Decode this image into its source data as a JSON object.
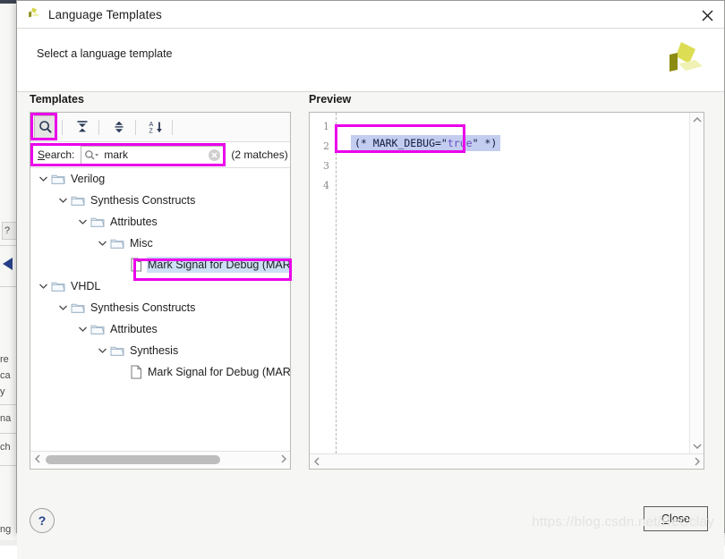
{
  "window": {
    "title": "Language Templates",
    "close_icon": "close-x-icon",
    "app_logo": "xilinx-logo-icon"
  },
  "header": {
    "subtitle": "Select a language template",
    "logo": "xilinx-vivado-logo-icon"
  },
  "templates": {
    "panel_title": "Templates",
    "toolbar": [
      {
        "name": "search-toggle",
        "icon": "magnifier-icon",
        "active": true
      },
      {
        "name": "collapse-all",
        "icon": "collapse-all-icon",
        "active": false
      },
      {
        "name": "expand-all",
        "icon": "expand-all-icon",
        "active": false
      },
      {
        "name": "sort-az",
        "icon": "sort-alpha-down-icon",
        "active": false
      }
    ],
    "search": {
      "label": "Search:",
      "label_mnemonic": "S",
      "value": "mark",
      "placeholder": "",
      "icon": "magnifier-dropdown-icon",
      "clear_icon": "clear-circle-icon",
      "match_count": "(2 matches)"
    },
    "tree": [
      {
        "label": "Verilog",
        "depth": 0,
        "type": "folder",
        "expanded": true,
        "selected": false
      },
      {
        "label": "Synthesis Constructs",
        "depth": 1,
        "type": "folder",
        "expanded": true,
        "selected": false
      },
      {
        "label": "Attributes",
        "depth": 2,
        "type": "folder",
        "expanded": true,
        "selected": false
      },
      {
        "label": "Misc",
        "depth": 3,
        "type": "folder",
        "expanded": true,
        "selected": false
      },
      {
        "label": "Mark Signal for Debug (MARK",
        "depth": 4,
        "type": "file",
        "expanded": false,
        "selected": true
      },
      {
        "label": "VHDL",
        "depth": 0,
        "type": "folder",
        "expanded": true,
        "selected": false
      },
      {
        "label": "Synthesis Constructs",
        "depth": 1,
        "type": "folder",
        "expanded": true,
        "selected": false
      },
      {
        "label": "Attributes",
        "depth": 2,
        "type": "folder",
        "expanded": true,
        "selected": false
      },
      {
        "label": "Synthesis",
        "depth": 3,
        "type": "folder",
        "expanded": true,
        "selected": false
      },
      {
        "label": "Mark Signal for Debug (MARK",
        "depth": 4,
        "type": "file",
        "expanded": false,
        "selected": false
      }
    ],
    "hscroll": {
      "left_icon": "chevron-left-icon",
      "right_icon": "chevron-right-icon"
    }
  },
  "preview": {
    "panel_title": "Preview",
    "line_numbers": [
      "1",
      "2",
      "3",
      "4"
    ],
    "code_prefix": "(* MARK_DEBUG=\"",
    "code_literal": "true",
    "code_suffix": "\" *)",
    "code_full": "(* MARK_DEBUG=\"true\" *)",
    "vscroll": {
      "up_icon": "chevron-up-icon",
      "down_icon": "chevron-down-icon"
    },
    "hscroll": {
      "left_icon": "chevron-left-icon",
      "right_icon": "chevron-right-icon"
    }
  },
  "footer": {
    "help_label": "?",
    "close_label": "Close",
    "close_mnemonic": "C"
  },
  "annotations": {
    "color": "#ea00ea",
    "boxes": [
      "search-toolbar-button",
      "search-field",
      "selected-tree-item",
      "preview-code-line"
    ]
  },
  "watermark": "https://blog.csdn.net/ReCclay",
  "background_fragments": [
    "?",
    "re",
    "ca",
    "y",
    "na",
    "ch",
    "ng"
  ]
}
